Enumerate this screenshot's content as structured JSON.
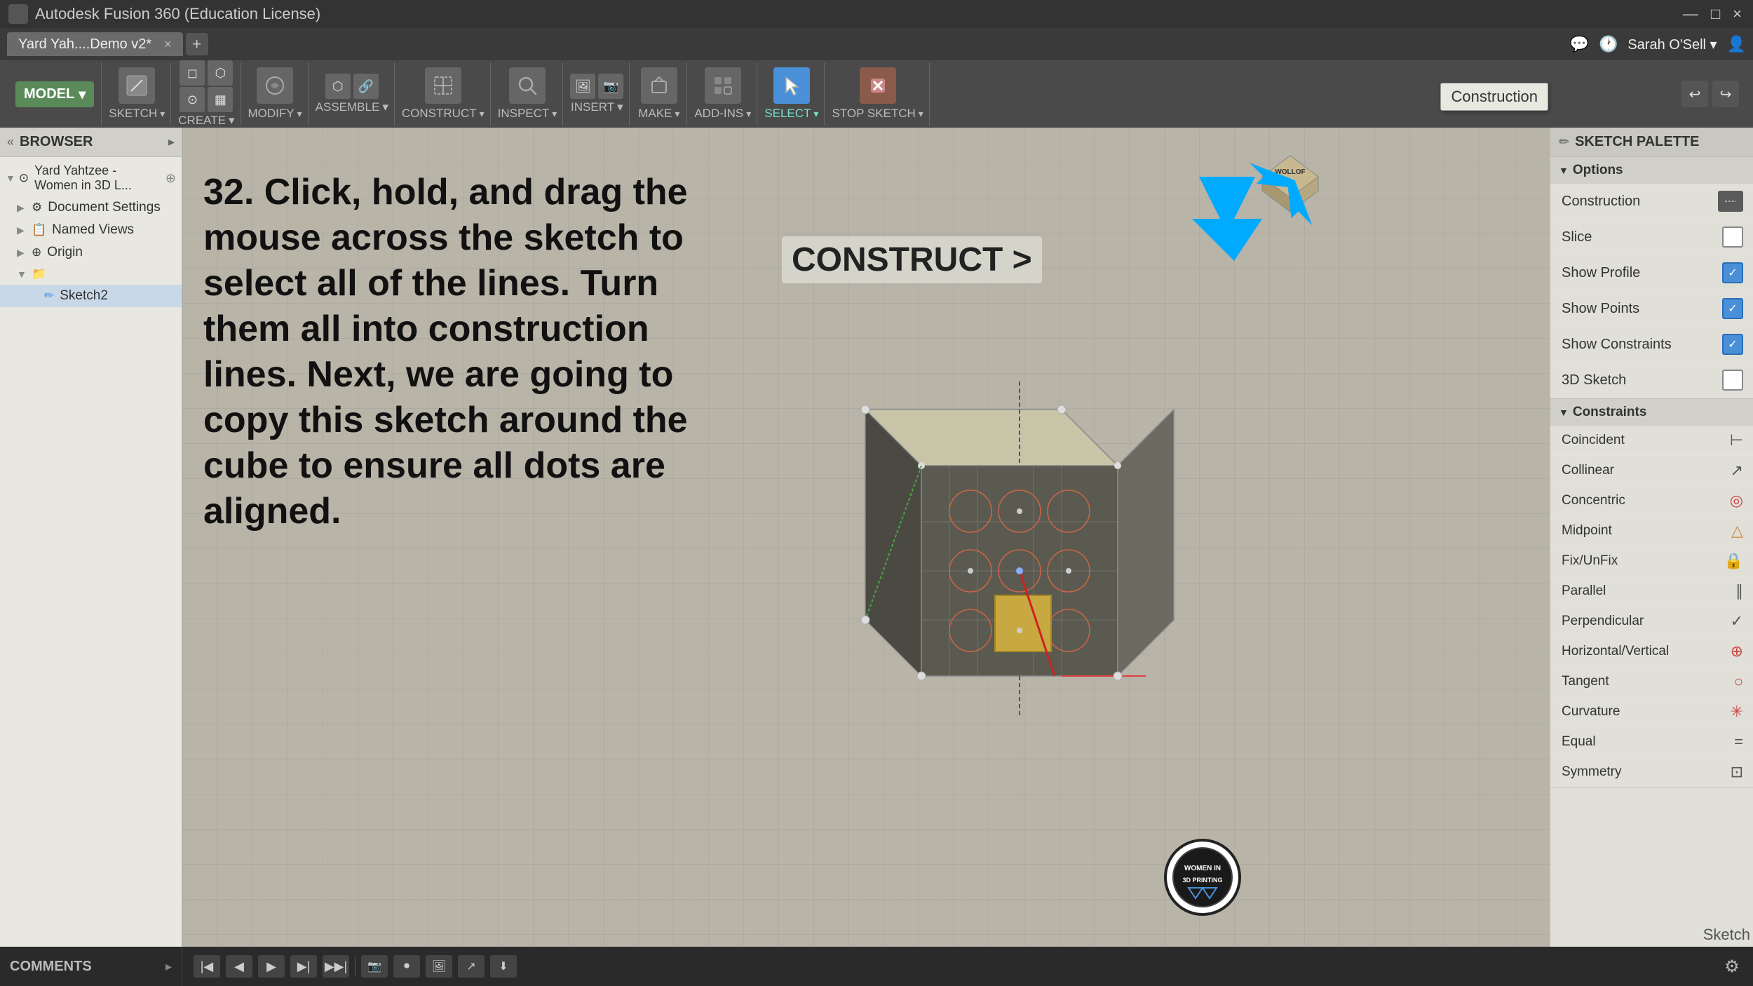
{
  "window": {
    "title": "Autodesk Fusion 360 (Education License)",
    "tab_label": "Yard Yah....Demo v2*",
    "close": "×",
    "minimize": "—",
    "maximize": "□"
  },
  "toolbar": {
    "groups": [
      {
        "id": "sketch",
        "label": "SKETCH",
        "has_arrow": true
      },
      {
        "id": "create",
        "label": "CREATE",
        "has_arrow": true
      },
      {
        "id": "modify",
        "label": "MODIFY",
        "has_arrow": true
      },
      {
        "id": "assemble",
        "label": "ASSEMBLE",
        "has_arrow": true
      },
      {
        "id": "construct",
        "label": "CONSTRUCT",
        "has_arrow": true
      },
      {
        "id": "inspect",
        "label": "INSPECT",
        "has_arrow": true
      },
      {
        "id": "insert",
        "label": "INSERT",
        "has_arrow": true
      },
      {
        "id": "make",
        "label": "MAKE",
        "has_arrow": true
      },
      {
        "id": "addins",
        "label": "ADD-INS",
        "has_arrow": true
      },
      {
        "id": "select",
        "label": "SELECT",
        "has_arrow": true,
        "active": true
      },
      {
        "id": "stopsketch",
        "label": "STOP SKETCH",
        "has_arrow": true
      }
    ],
    "mode_label": "MODEL"
  },
  "browser": {
    "title": "BROWSER",
    "tree_items": [
      {
        "label": "Yard Yahtzee - Women in 3D L...",
        "level": 0,
        "expanded": true,
        "has_icon": true
      },
      {
        "label": "Document Settings",
        "level": 1,
        "expanded": false
      },
      {
        "label": "Named Views",
        "level": 1,
        "expanded": false
      },
      {
        "label": "Origin",
        "level": 1,
        "expanded": false
      },
      {
        "label": "(group)",
        "level": 1,
        "expanded": true
      },
      {
        "label": "Sketch2",
        "level": 2,
        "expanded": false,
        "selected": true
      }
    ]
  },
  "instruction": {
    "number": "32.",
    "text": " Click, hold, and drag the mouse across the sketch to select all of the lines. Turn them all into construction lines. Next, we are going to copy this sketch around the cube to ensure all dots are aligned."
  },
  "construct_label": "CONSTRUCT >",
  "sketch_palette": {
    "title": "SKETCH PALETTE",
    "sections": {
      "options": {
        "label": "Options",
        "rows": [
          {
            "id": "construction",
            "label": "Construction",
            "type": "button_check",
            "checked": false
          },
          {
            "id": "slice",
            "label": "Slice",
            "type": "check",
            "checked": false
          },
          {
            "id": "show_profile",
            "label": "Show Profile",
            "type": "check",
            "checked": true
          },
          {
            "id": "show_points",
            "label": "Show Points",
            "type": "check",
            "checked": true
          },
          {
            "id": "show_constraints",
            "label": "Show Constraints",
            "type": "check",
            "checked": true
          },
          {
            "id": "3d_sketch",
            "label": "3D Sketch",
            "type": "check",
            "checked": false
          }
        ]
      },
      "constraints": {
        "label": "Constraints",
        "items": [
          {
            "id": "coincident",
            "label": "Coincident",
            "icon": "⊢"
          },
          {
            "id": "collinear",
            "label": "Collinear",
            "icon": "↗"
          },
          {
            "id": "concentric",
            "label": "Concentric",
            "icon": "◎"
          },
          {
            "id": "midpoint",
            "label": "Midpoint",
            "icon": "△"
          },
          {
            "id": "fix_unfix",
            "label": "Fix/UnFix",
            "icon": "🔒"
          },
          {
            "id": "parallel",
            "label": "Parallel",
            "icon": "∥"
          },
          {
            "id": "perpendicular",
            "label": "Perpendicular",
            "icon": "✓"
          },
          {
            "id": "horizontal_vertical",
            "label": "Horizontal/Vertical",
            "icon": "⊕"
          },
          {
            "id": "tangent",
            "label": "Tangent",
            "icon": "○"
          },
          {
            "id": "curvature",
            "label": "Curvature",
            "icon": "✳"
          },
          {
            "id": "equal",
            "label": "Equal",
            "icon": "="
          },
          {
            "id": "symmetry",
            "label": "Symmetry",
            "icon": "⊡"
          }
        ]
      }
    }
  },
  "construction_tooltip": "Construction",
  "comments": {
    "label": "COMMENTS"
  },
  "logo": {
    "line1": "WOMEN IN",
    "line2": "3D PRINTING",
    "sketch_label": "Sketch"
  },
  "view_cube": {
    "label": "WOLLOF"
  },
  "bottom_controls": {
    "buttons": [
      "⊕",
      "●",
      "✋",
      "◈",
      "🔍",
      "⬜",
      "⬜",
      "☰"
    ]
  }
}
